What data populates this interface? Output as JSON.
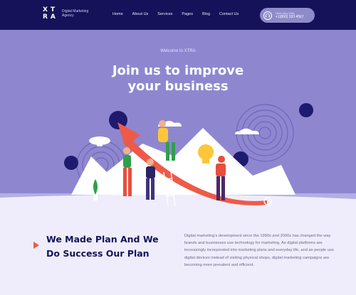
{
  "brand": {
    "mark": "XT RA",
    "text": "Digital Marketing Agency"
  },
  "nav": [
    "Home",
    "About Us",
    "Services",
    "Pages",
    "Blog",
    "Contact Us"
  ],
  "help": {
    "label": "Need Any Help",
    "phone": "+1(800) 333 4567"
  },
  "hero": {
    "subtitle": "Welcome to XTRA",
    "title_line1": "Join us to improve",
    "title_line2": "your business"
  },
  "section": {
    "title_line1": "We Made Plan And We",
    "title_line2": "Do Success Our Plan",
    "body": "Digital marketing's development since the 1990s and 2000s has changed the way brands and businesses use technology for marketing. As digital platforms are increasingly incorporated into marketing plans and everyday life, and as people use digital devices instead of visiting physical shops, digital marketing campaigns are becoming more prevalent and efficient."
  },
  "colors": {
    "navy": "#15125a",
    "hero": "#8e87d0",
    "accent": "#ef5a48",
    "background": "#efedfb"
  },
  "icons": {
    "help": "headset-icon",
    "section": "play-arrow-icon"
  }
}
